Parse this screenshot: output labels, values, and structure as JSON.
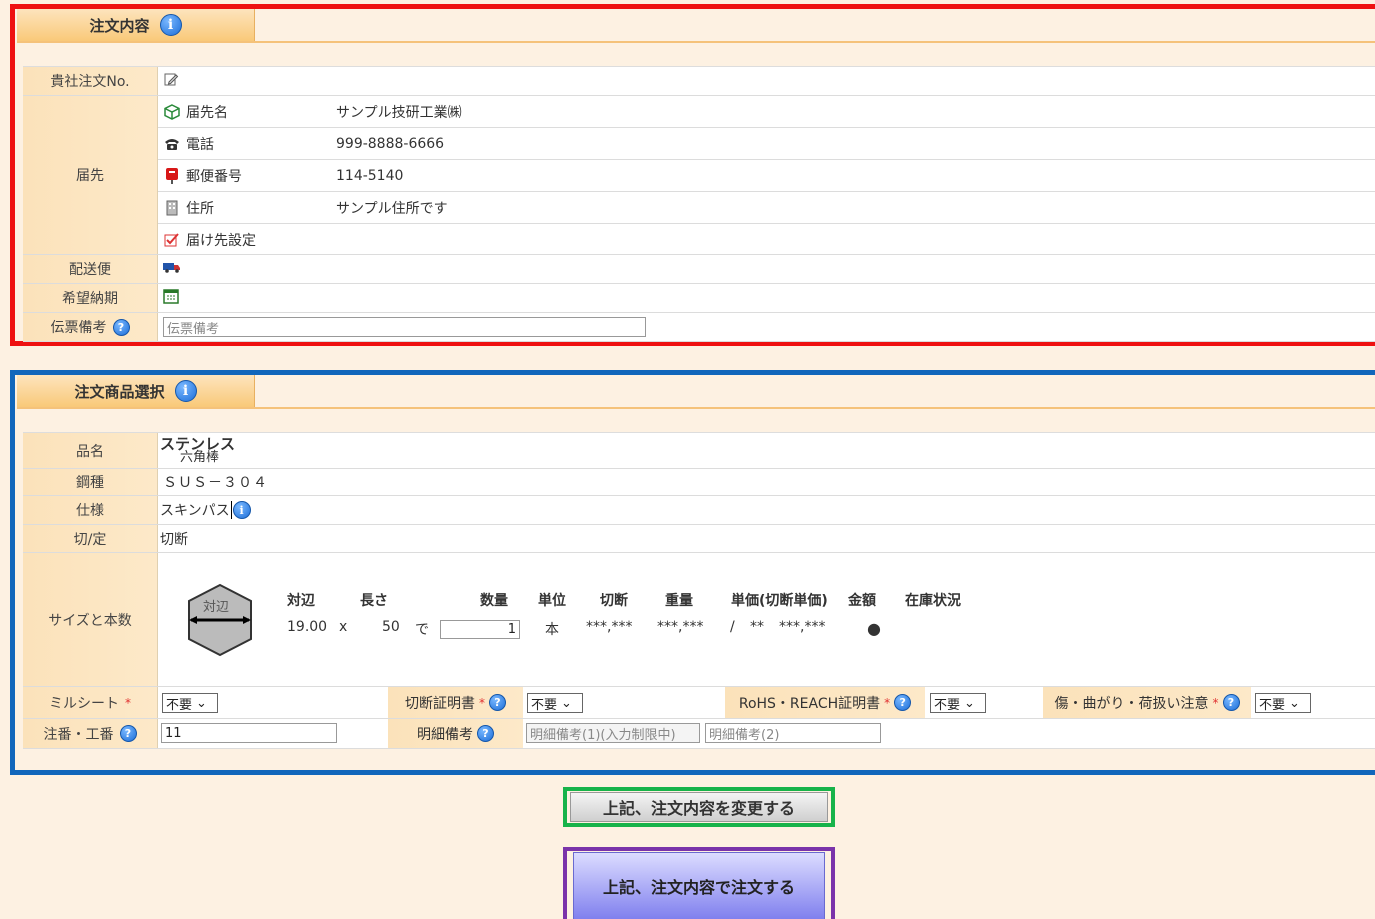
{
  "order_section": {
    "title": "注文内容",
    "rows": {
      "order_no_label": "貴社注文No.",
      "dest_label": "届先",
      "dest_name_label": "届先名",
      "dest_name_value": "サンプル技研工業㈱",
      "phone_label": "電話",
      "phone_value": "999-8888-6666",
      "postal_label": "郵便番号",
      "postal_value": "114-5140",
      "address_label": "住所",
      "address_value": "サンプル住所です",
      "dest_setting_label": "届け先設定",
      "delivery_label": "配送便",
      "desired_date_label": "希望納期",
      "slip_note_label": "伝票備考",
      "slip_note_placeholder": "伝票備考"
    }
  },
  "product_section": {
    "title": "注文商品選択",
    "product_name_label": "品名",
    "product_name_line1": "ステンレス",
    "product_name_line2": "六角棒",
    "steel_label": "鋼種",
    "steel_value": "ＳＵＳ－３０４",
    "spec_label": "仕様",
    "spec_value": "スキンパス",
    "cut_label": "切/定",
    "cut_value": "切断",
    "size_label": "サイズと本数",
    "shape_label": "対辺",
    "headers": [
      "対辺",
      "長さ",
      "数量",
      "単位",
      "切断",
      "重量",
      "単価(切断単価)",
      "金額",
      "在庫状況"
    ],
    "values": {
      "across": "19.00",
      "x": "x",
      "length": "50",
      "de": "で",
      "qty": "1",
      "unit": "本",
      "cut": "***,***",
      "weight": "***,***",
      "slash": "/",
      "unit_price": "**",
      "amount": "***,***",
      "stock": "●"
    },
    "mill_sheet_label": "ミルシート",
    "mill_sheet_value": "不要",
    "cut_cert_label": "切断証明書",
    "cut_cert_value": "不要",
    "rohs_label": "RoHS・REACH証明書",
    "rohs_value": "不要",
    "damage_label": "傷・曲がり・荷扱い注意",
    "damage_value": "不要",
    "required_mark": "*",
    "order_no_label": "注番・工番",
    "order_no_value": "11",
    "detail_note_label": "明細備考",
    "detail_note1_placeholder": "明細備考(1)(入力制限中)",
    "detail_note2_placeholder": "明細備考(2)"
  },
  "buttons": {
    "change": "上記、注文内容を変更する",
    "order": "上記、注文内容で注文する"
  },
  "colors": {
    "red_frame": "#ee1111",
    "blue_frame": "#1166bb",
    "green_frame": "#17b34a",
    "purple_frame": "#7a33aa"
  }
}
